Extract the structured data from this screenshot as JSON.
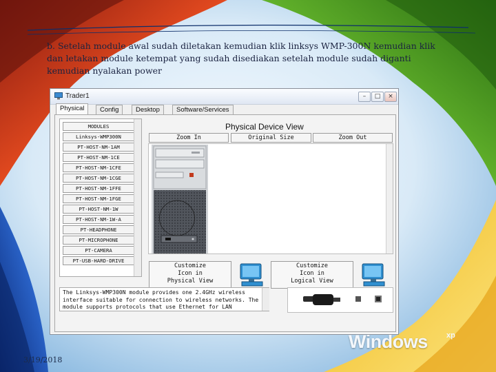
{
  "slide": {
    "instruction": "b. Setelah module awal sudah diletakan kemudian klik linksys WMP-300N kemudian klik dan letakan module ketempat yang sudah disediakan setelah module sudah diganti kemudian nyalakan power",
    "date": "3/19/2018",
    "os_logo": "Windows",
    "os_logo_sup": "xp"
  },
  "window": {
    "title": "Trader1",
    "controls": {
      "minimize": "–",
      "maximize": "□",
      "close": "×"
    },
    "tabs": [
      {
        "label": "Physical",
        "active": true
      },
      {
        "label": "Config"
      },
      {
        "label": "Desktop"
      },
      {
        "label": "Software/Services"
      }
    ]
  },
  "module_list": {
    "items": [
      "MODULES",
      "Linksys-WMP300N",
      "PT-HOST-NM-1AM",
      "PT-HOST-NM-1CE",
      "PT-HOST-NM-1CFE",
      "PT-HOST-NM-1CGE",
      "PT-HOST-NM-1FFE",
      "PT-HOST-NM-1FGE",
      "PT-HOST-NM-1W",
      "PT-HOST-NM-1W-A",
      "PT-HEADPHONE",
      "PT-MICROPHONE",
      "PT-CAMERA",
      "PT-USB-HARD-DRIVE"
    ]
  },
  "device_view": {
    "title": "Physical Device View",
    "zoom_in": "Zoom In",
    "original_size": "Original Size",
    "zoom_out": "Zoom Out"
  },
  "customize": {
    "physical": [
      "Customize",
      "Icon in",
      "Physical View"
    ],
    "logical": [
      "Customize",
      "Icon in",
      "Logical View"
    ]
  },
  "description": {
    "lines": [
      "The Linksys-WMP300N module provides one 2.4GHz wireless",
      "interface suitable for connection to wireless networks. The",
      "module supports protocols that use Ethernet for LAN"
    ]
  },
  "colors": {
    "window_bg": "#f0f0f0",
    "monitor_blue": "#2f8fd0",
    "case_dark": "#4c4f55"
  }
}
